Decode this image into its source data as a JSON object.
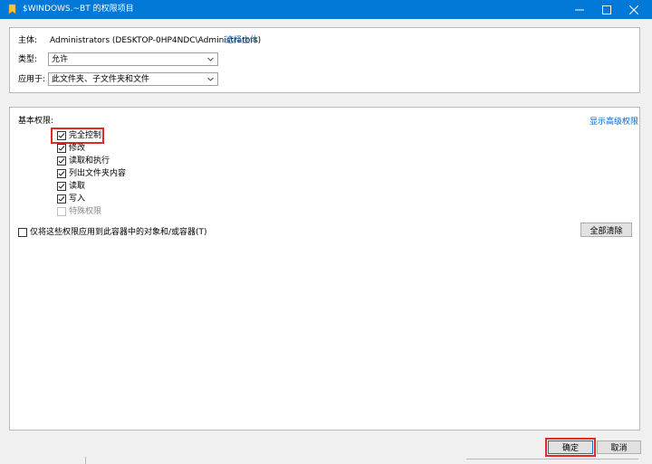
{
  "window": {
    "title": "$WINDOWS.~BT 的权限项目",
    "icons": [
      "folder-icon",
      "minimize-icon",
      "maximize-icon",
      "close-icon"
    ]
  },
  "principal": {
    "label": "主体:",
    "value": "Administrators (DESKTOP-0HP4NDC\\Administrators)",
    "link": "选择主体"
  },
  "type": {
    "label": "类型:",
    "value": "允许"
  },
  "applies_to": {
    "label": "应用于:",
    "value": "此文件夹、子文件夹和文件"
  },
  "permissions": {
    "heading": "基本权限:",
    "advanced_link": "显示高级权限",
    "items": [
      {
        "label": "完全控制",
        "checked": true,
        "enabled": true
      },
      {
        "label": "修改",
        "checked": true,
        "enabled": true
      },
      {
        "label": "读取和执行",
        "checked": true,
        "enabled": true
      },
      {
        "label": "列出文件夹内容",
        "checked": true,
        "enabled": true
      },
      {
        "label": "读取",
        "checked": true,
        "enabled": true
      },
      {
        "label": "写入",
        "checked": true,
        "enabled": true
      },
      {
        "label": "特殊权限",
        "checked": false,
        "enabled": false
      }
    ]
  },
  "apply_only": {
    "label": "仅将这些权限应用到此容器中的对象和/或容器(T)",
    "checked": false
  },
  "buttons": {
    "clear_all": "全部清除",
    "ok": "确定",
    "cancel": "取消"
  },
  "colors": {
    "titlebar": "#0078d7",
    "link": "#0066cc",
    "highlight": "#e02a2a"
  }
}
